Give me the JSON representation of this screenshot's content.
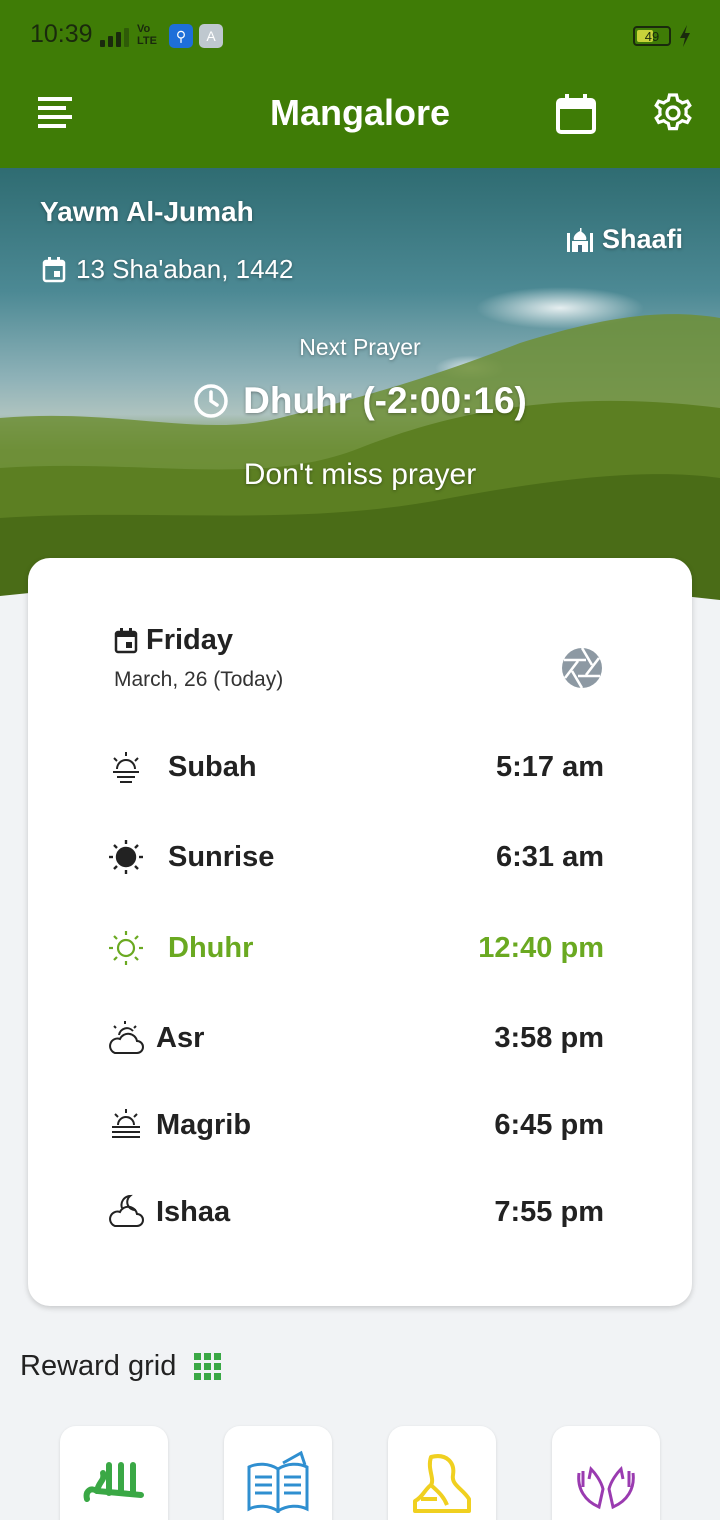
{
  "status_bar": {
    "time": "10:39",
    "network": "Vo LTE",
    "battery": "49"
  },
  "app_bar": {
    "title": "Mangalore",
    "menu_icon": "menu-icon",
    "calendar_icon": "calendar-icon",
    "settings_icon": "gear-icon",
    "color": "#3f7c06"
  },
  "hero": {
    "day_name": "Yawm Al-Jumah",
    "hijri_date": "13 Sha'aban, 1442",
    "madhab": "Shaafi",
    "next_prayer_label": "Next Prayer",
    "next_prayer": "Dhuhr (-2:00:16)",
    "reminder": "Don't miss prayer"
  },
  "card": {
    "day": "Friday",
    "date": "March, 26 (Today)",
    "prayers": [
      {
        "name": "Subah",
        "time": "5:17 am",
        "icon": "sunrise-low-icon",
        "active": false
      },
      {
        "name": "Sunrise",
        "time": "6:31 am",
        "icon": "sun-filled-icon",
        "active": false
      },
      {
        "name": "Dhuhr",
        "time": "12:40 pm",
        "icon": "sun-outline-icon",
        "active": true
      },
      {
        "name": "Asr",
        "time": "3:58 pm",
        "icon": "sun-cloud-icon",
        "active": false
      },
      {
        "name": "Magrib",
        "time": "6:45 pm",
        "icon": "sunset-haze-icon",
        "active": false
      },
      {
        "name": "Ishaa",
        "time": "7:55 pm",
        "icon": "moon-cloud-icon",
        "active": false
      }
    ],
    "active_color": "#6aa921"
  },
  "reward_grid": {
    "title": "Reward grid",
    "tiles": [
      {
        "icon": "allah-calligraphy-icon",
        "color": "#3aa845"
      },
      {
        "icon": "open-book-icon",
        "color": "#2f8fd0"
      },
      {
        "icon": "praying-person-icon",
        "color": "#f0d020"
      },
      {
        "icon": "dua-hands-icon",
        "color": "#9a3bb0"
      }
    ]
  }
}
